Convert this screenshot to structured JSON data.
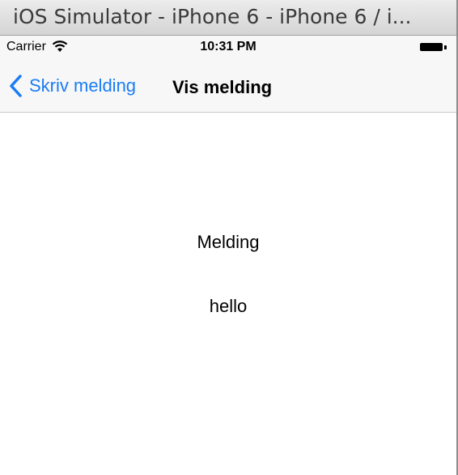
{
  "window": {
    "title": "iOS Simulator - iPhone 6 - iPhone 6 / i..."
  },
  "status_bar": {
    "carrier": "Carrier",
    "time": "10:31 PM",
    "icons": [
      "wifi-icon",
      "battery-icon"
    ]
  },
  "nav_bar": {
    "back_label": "Skriv melding",
    "title": "Vis melding",
    "back_icon": "chevron-left-icon",
    "accent_color": "#1a7cf5"
  },
  "content": {
    "heading": "Melding",
    "message": "hello"
  }
}
